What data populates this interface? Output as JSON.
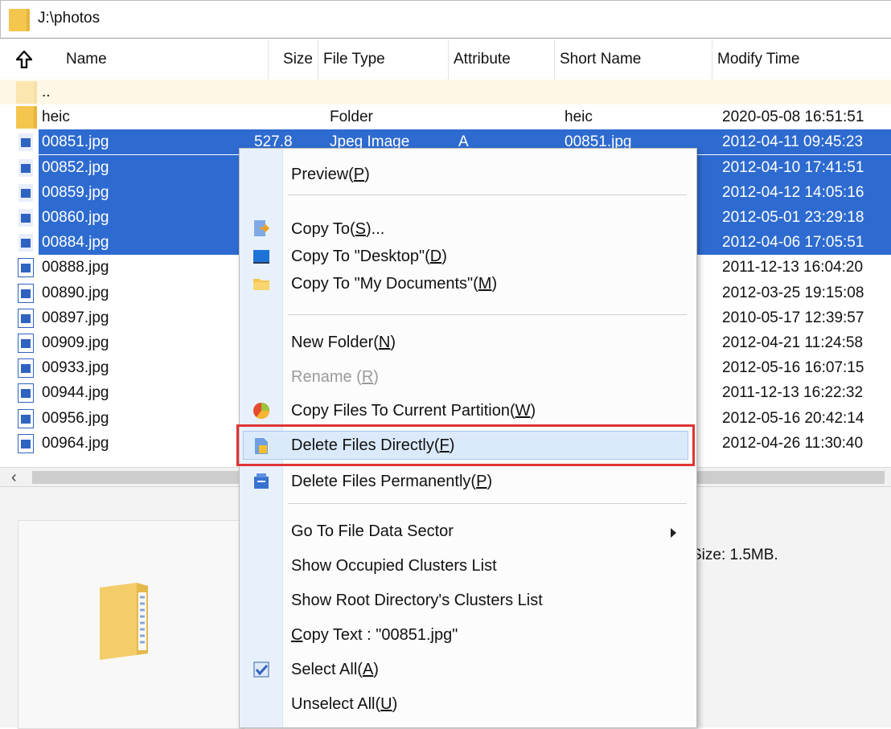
{
  "path": "J:\\photos",
  "columns": {
    "name": "Name",
    "size": "Size",
    "type": "File Type",
    "attribute": "Attribute",
    "short": "Short Name",
    "modify": "Modify Time"
  },
  "rows": [
    {
      "name": "..",
      "size": "",
      "type": "",
      "attr": "",
      "short": "",
      "modify": "",
      "kind": "parent"
    },
    {
      "name": "heic",
      "size": "",
      "type": "Folder",
      "attr": "",
      "short": "heic",
      "modify": "2020-05-08 16:51:51",
      "kind": "folder"
    },
    {
      "name": "00851.jpg",
      "size": "527.8",
      "type": "Jpeg Image",
      "attr": "A",
      "short": "00851.jpg",
      "modify": "2012-04-11 09:45:23",
      "kind": "file",
      "selected": true
    },
    {
      "name": "00852.jpg",
      "size": "",
      "type": "",
      "attr": "",
      "short": "",
      "modify": "2012-04-10 17:41:51",
      "kind": "file",
      "selected": true
    },
    {
      "name": "00859.jpg",
      "size": "",
      "type": "",
      "attr": "",
      "short": "",
      "modify": "2012-04-12 14:05:16",
      "kind": "file",
      "selected": true
    },
    {
      "name": "00860.jpg",
      "size": "",
      "type": "",
      "attr": "",
      "short": "",
      "modify": "2012-05-01 23:29:18",
      "kind": "file",
      "selected": true
    },
    {
      "name": "00884.jpg",
      "size": "",
      "type": "",
      "attr": "",
      "short": "",
      "modify": "2012-04-06 17:05:51",
      "kind": "file",
      "selected": true
    },
    {
      "name": "00888.jpg",
      "size": "",
      "type": "",
      "attr": "",
      "short": "",
      "modify": "2011-12-13 16:04:20",
      "kind": "file"
    },
    {
      "name": "00890.jpg",
      "size": "",
      "type": "",
      "attr": "",
      "short": "",
      "modify": "2012-03-25 19:15:08",
      "kind": "file"
    },
    {
      "name": "00897.jpg",
      "size": "",
      "type": "",
      "attr": "",
      "short": "",
      "modify": "2010-05-17 12:39:57",
      "kind": "file"
    },
    {
      "name": "00909.jpg",
      "size": "",
      "type": "",
      "attr": "",
      "short": "",
      "modify": "2012-04-21 11:24:58",
      "kind": "file"
    },
    {
      "name": "00933.jpg",
      "size": "",
      "type": "",
      "attr": "",
      "short": "",
      "modify": "2012-05-16 16:07:15",
      "kind": "file"
    },
    {
      "name": "00944.jpg",
      "size": "",
      "type": "",
      "attr": "",
      "short": "",
      "modify": "2011-12-13 16:22:32",
      "kind": "file"
    },
    {
      "name": "00956.jpg",
      "size": "",
      "type": "",
      "attr": "",
      "short": "",
      "modify": "2012-05-16 20:42:14",
      "kind": "file"
    },
    {
      "name": "00964.jpg",
      "size": "",
      "type": "",
      "attr": "",
      "short": "",
      "modify": "2012-04-26 11:30:40",
      "kind": "file"
    }
  ],
  "bottom": {
    "size_info": "Size: 1.5MB."
  },
  "menu": {
    "preview": {
      "text": "Preview(",
      "key": "P",
      "end": ")"
    },
    "copy_to": {
      "text": "Copy To(",
      "key": "S",
      "end": ")..."
    },
    "copy_desktop": {
      "text": "Copy To \"Desktop\"(",
      "key": "D",
      "end": ")"
    },
    "copy_mydocs": {
      "text": "Copy To \"My Documents\"(",
      "key": "M",
      "end": ")"
    },
    "new_folder": {
      "text": "New Folder(",
      "key": "N",
      "end": ")"
    },
    "rename": {
      "text": "Rename (",
      "key": "R",
      "end": ")"
    },
    "copy_partition": {
      "text": "Copy Files To Current Partition(",
      "key": "W",
      "end": ")"
    },
    "delete_directly": {
      "text": "Delete Files Directly(",
      "key": "F",
      "end": ")"
    },
    "delete_permanently": {
      "text": "Delete Files Permanently(",
      "key": "P",
      "end": ")"
    },
    "goto_sector": {
      "text": "Go To File Data Sector"
    },
    "occupied_clusters": {
      "text": "Show Occupied Clusters List"
    },
    "root_clusters": {
      "text": "Show Root Directory's Clusters List"
    },
    "copy_text": {
      "key": "C",
      "text": "opy Text : \"00851.jpg\""
    },
    "select_all": {
      "text": "Select All(",
      "key": "A",
      "end": ")"
    },
    "unselect_all": {
      "text": "Unselect All(",
      "key": "U",
      "end": ")"
    }
  },
  "colors": {
    "selection": "#2e6bd0",
    "highlight_box": "#e03434",
    "folder": "#f4c64e"
  }
}
